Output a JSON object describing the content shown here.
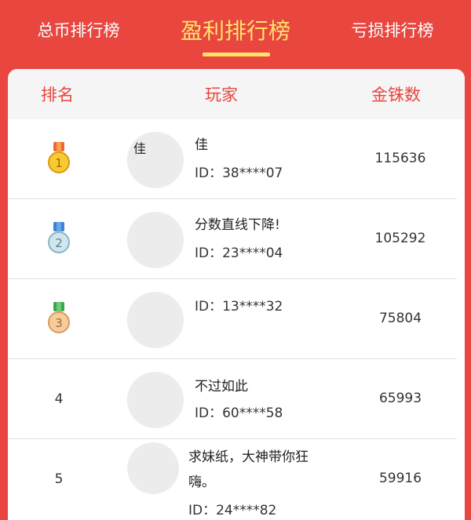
{
  "tabs": [
    {
      "label": "总币排行榜",
      "active": false
    },
    {
      "label": "盈利排行榜",
      "active": true
    },
    {
      "label": "亏损排行榜",
      "active": false
    }
  ],
  "colors": {
    "background": "#e8463f",
    "active_tab": "#ffe36b",
    "header_text": "#e8463f"
  },
  "columns": {
    "rank": "排名",
    "player": "玩家",
    "coins": "金铢数"
  },
  "rows": [
    {
      "rank": "1",
      "medal": "gold-medal-icon",
      "avatar_text": "佳",
      "name": "佳",
      "id": "ID：38****07",
      "coins": "115636"
    },
    {
      "rank": "2",
      "medal": "silver-medal-icon",
      "name": "分数直线下降!",
      "id": "ID：23****04",
      "coins": "105292"
    },
    {
      "rank": "3",
      "medal": "bronze-medal-icon",
      "name": "",
      "id": "ID：13****32",
      "coins": "75804"
    },
    {
      "rank": "4",
      "name": "不过如此",
      "id": "ID：60****58",
      "coins": "65993"
    },
    {
      "rank": "5",
      "name_line1": "求妹纸，大神带你狂",
      "name_line2": "嗨。",
      "id": "ID：24****82",
      "coins": "59916"
    }
  ]
}
